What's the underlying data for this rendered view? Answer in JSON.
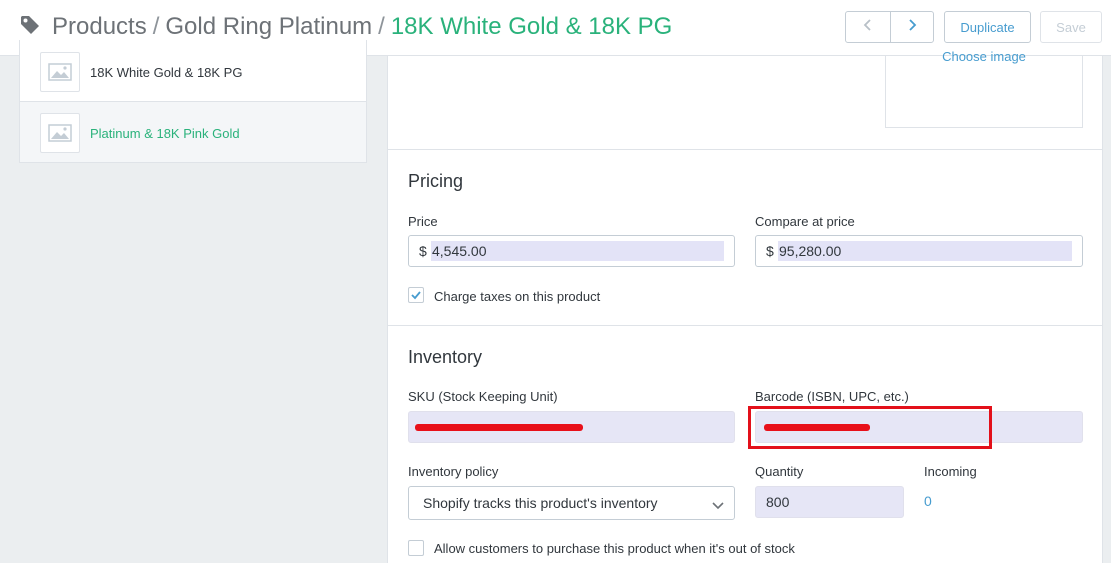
{
  "header": {
    "breadcrumb": [
      "Products",
      "Gold Ring Platinum"
    ],
    "current": "18K White Gold & 18K PG",
    "separator": "/",
    "duplicate_label": "Duplicate",
    "save_label": "Save"
  },
  "variants": [
    {
      "label": "18K White Gold & 18K PG",
      "active": false
    },
    {
      "label": "Platinum & 18K Pink Gold",
      "active": true
    }
  ],
  "image_box": {
    "choose_label": "Choose image"
  },
  "pricing": {
    "title": "Pricing",
    "price_label": "Price",
    "currency": "$",
    "price_value": "4,545.00",
    "compare_label": "Compare at price",
    "compare_value": "95,280.00",
    "taxes_label": "Charge taxes on this product",
    "taxes_checked": true
  },
  "inventory": {
    "title": "Inventory",
    "sku_label": "SKU (Stock Keeping Unit)",
    "barcode_label": "Barcode (ISBN, UPC, etc.)",
    "policy_label": "Inventory policy",
    "policy_value": "Shopify tracks this product's inventory",
    "quantity_label": "Quantity",
    "quantity_value": "800",
    "incoming_label": "Incoming",
    "incoming_value": "0",
    "allow_oos_label": "Allow customers to purchase this product when it's out of stock",
    "allow_oos_checked": false
  },
  "colors": {
    "accent_green": "#2ab27b",
    "link_blue": "#479ccf",
    "redaction_red": "#e3101a"
  },
  "icons": [
    "tag-icon",
    "chevron-left-icon",
    "chevron-right-icon",
    "image-placeholder-icon",
    "checkmark-icon",
    "chevron-down-icon"
  ]
}
